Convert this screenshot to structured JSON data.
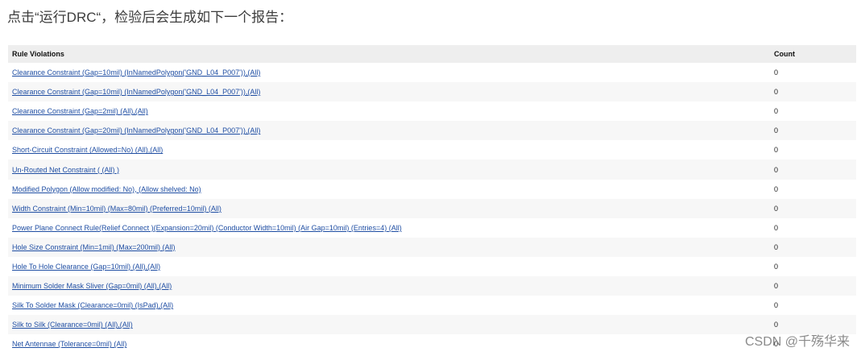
{
  "intro_text": "点击“运行DRC“，检验后会生成如下一个报告：",
  "table": {
    "headers": {
      "rule": "Rule Violations",
      "count": "Count"
    },
    "rows": [
      {
        "rule": "Clearance Constraint (Gap=10mil) (InNamedPolygon('GND_L04_P007')),(All)",
        "count": "0"
      },
      {
        "rule": "Clearance Constraint (Gap=10mil) (InNamedPolygon('GND_L04_P007')),(All)",
        "count": "0"
      },
      {
        "rule": "Clearance Constraint (Gap=2mil) (All),(All)",
        "count": "0"
      },
      {
        "rule": "Clearance Constraint (Gap=20mil) (InNamedPolygon('GND_L04_P007')),(All)",
        "count": "0"
      },
      {
        "rule": "Short-Circuit Constraint (Allowed=No) (All),(All)",
        "count": "0"
      },
      {
        "rule": "Un-Routed Net Constraint ( (All) )",
        "count": "0"
      },
      {
        "rule": "Modified Polygon (Allow modified: No), (Allow shelved: No)",
        "count": "0"
      },
      {
        "rule": "Width Constraint (Min=10mil) (Max=80mil) (Preferred=10mil) (All)",
        "count": "0"
      },
      {
        "rule": "Power Plane Connect Rule(Relief Connect )(Expansion=20mil) (Conductor Width=10mil) (Air Gap=10mil) (Entries=4) (All)",
        "count": "0"
      },
      {
        "rule": "Hole Size Constraint (Min=1mil) (Max=200mil) (All)",
        "count": "0"
      },
      {
        "rule": "Hole To Hole Clearance (Gap=10mil) (All),(All)",
        "count": "0"
      },
      {
        "rule": "Minimum Solder Mask Sliver (Gap=0mil) (All),(All)",
        "count": "0"
      },
      {
        "rule": "Silk To Solder Mask (Clearance=0mil) (IsPad),(All)",
        "count": "0"
      },
      {
        "rule": "Silk to Silk (Clearance=0mil) (All),(All)",
        "count": "0"
      },
      {
        "rule": "Net Antennae (Tolerance=0mil) (All)",
        "count": "0"
      }
    ]
  },
  "watermark": "CSDN @千殇华来",
  "colors": {
    "link": "#1f4ea3",
    "header_bg": "#eeeeee",
    "row_alt_bg": "#f7f7f7"
  }
}
